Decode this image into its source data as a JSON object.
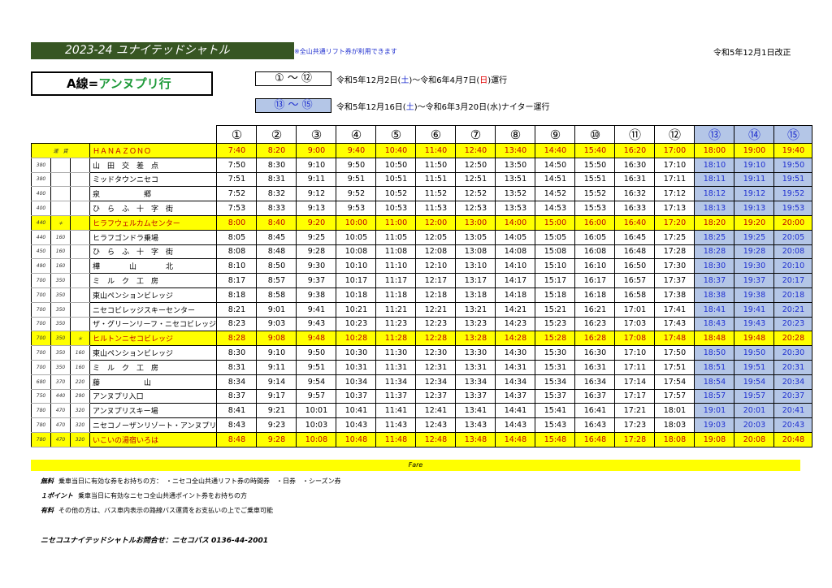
{
  "title": "2023-24  ユナイテッドシャトル",
  "note": "※全山共通リフト券が利用できます",
  "revision": "令和5年12月1日改正",
  "route": {
    "prefix": "A線=",
    "name": "アンヌプリ行"
  },
  "legend1": {
    "label": "① ～ ⑫",
    "p1": "令和5年12月2日(",
    "d1": "土",
    "p2": ")～令和6年4月7日(",
    "d2": "日",
    "p3": ")運行"
  },
  "legend2": {
    "label": "⑬ ～ ⑮",
    "p1": "令和5年12月16日(",
    "d1": "土",
    "p2": ")～令和6年3月20日(水)ナイター運行"
  },
  "trip_labels": [
    "①",
    "②",
    "③",
    "④",
    "⑤",
    "⑥",
    "⑦",
    "⑧",
    "⑨",
    "⑩",
    "⑪",
    "⑫",
    "⑬",
    "⑭",
    "⑮"
  ],
  "fare_header": "運　賃",
  "stops": [
    {
      "name": "ＨＡＮＡＺＯＮＯ",
      "f1": "",
      "f2": "",
      "f3": "",
      "hl": true,
      "times": [
        "7:40",
        "8:20",
        "9:00",
        "9:40",
        "10:40",
        "11:40",
        "12:40",
        "13:40",
        "14:40",
        "15:40",
        "16:20",
        "17:00",
        "18:00",
        "19:00",
        "19:40"
      ]
    },
    {
      "name": "山　田　交　差　点",
      "f1": "380",
      "f2": "",
      "f3": "",
      "times": [
        "7:50",
        "8:30",
        "9:10",
        "9:50",
        "10:50",
        "11:50",
        "12:50",
        "13:50",
        "14:50",
        "15:50",
        "16:30",
        "17:10",
        "18:10",
        "19:10",
        "19:50"
      ]
    },
    {
      "name": "ミッドタウンニセコ",
      "f1": "380",
      "f2": "",
      "f3": "",
      "times": [
        "7:51",
        "8:31",
        "9:11",
        "9:51",
        "10:51",
        "11:51",
        "12:51",
        "13:51",
        "14:51",
        "15:51",
        "16:31",
        "17:11",
        "18:11",
        "19:11",
        "19:51"
      ]
    },
    {
      "name": "泉　　　　　　郷",
      "f1": "400",
      "f2": "",
      "f3": "",
      "times": [
        "7:52",
        "8:32",
        "9:12",
        "9:52",
        "10:52",
        "11:52",
        "12:52",
        "13:52",
        "14:52",
        "15:52",
        "16:32",
        "17:12",
        "18:12",
        "19:12",
        "19:52"
      ]
    },
    {
      "name": "ひ　ら　ふ　十　字　街",
      "f1": "400",
      "f2": "",
      "f3": "",
      "times": [
        "7:53",
        "8:33",
        "9:13",
        "9:53",
        "10:53",
        "11:53",
        "12:53",
        "13:53",
        "14:53",
        "15:53",
        "16:33",
        "17:13",
        "18:13",
        "19:13",
        "19:53"
      ]
    },
    {
      "name": "ヒラフウェルカムセンター",
      "f1": "440",
      "f2": "＊",
      "f3": "",
      "hl": true,
      "times": [
        "8:00",
        "8:40",
        "9:20",
        "10:00",
        "11:00",
        "12:00",
        "13:00",
        "14:00",
        "15:00",
        "16:00",
        "16:40",
        "17:20",
        "18:20",
        "19:20",
        "20:00"
      ]
    },
    {
      "name": "ヒラフゴンドラ乗場",
      "f1": "440",
      "f2": "160",
      "f3": "",
      "times": [
        "8:05",
        "8:45",
        "9:25",
        "10:05",
        "11:05",
        "12:05",
        "13:05",
        "14:05",
        "15:05",
        "16:05",
        "16:45",
        "17:25",
        "18:25",
        "19:25",
        "20:05"
      ]
    },
    {
      "name": "ひ　ら　ふ　十　字　街",
      "f1": "450",
      "f2": "160",
      "f3": "",
      "times": [
        "8:08",
        "8:48",
        "9:28",
        "10:08",
        "11:08",
        "12:08",
        "13:08",
        "14:08",
        "15:08",
        "16:08",
        "16:48",
        "17:28",
        "18:28",
        "19:28",
        "20:08"
      ]
    },
    {
      "name": "樺　　　　山　　　　北",
      "f1": "490",
      "f2": "160",
      "f3": "",
      "times": [
        "8:10",
        "8:50",
        "9:30",
        "10:10",
        "11:10",
        "12:10",
        "13:10",
        "14:10",
        "15:10",
        "16:10",
        "16:50",
        "17:30",
        "18:30",
        "19:30",
        "20:10"
      ]
    },
    {
      "name": "ミ　ル　ク　工　房",
      "f1": "700",
      "f2": "350",
      "f3": "",
      "times": [
        "8:17",
        "8:57",
        "9:37",
        "10:17",
        "11:17",
        "12:17",
        "13:17",
        "14:17",
        "15:17",
        "16:17",
        "16:57",
        "17:37",
        "18:37",
        "19:37",
        "20:17"
      ]
    },
    {
      "name": "東山ペンションビレッジ",
      "f1": "700",
      "f2": "350",
      "f3": "",
      "times": [
        "8:18",
        "8:58",
        "9:38",
        "10:18",
        "11:18",
        "12:18",
        "13:18",
        "14:18",
        "15:18",
        "16:18",
        "16:58",
        "17:38",
        "18:38",
        "19:38",
        "20:18"
      ]
    },
    {
      "name": "ニセコビレッジスキーセンター",
      "f1": "700",
      "f2": "350",
      "f3": "",
      "times": [
        "8:21",
        "9:01",
        "9:41",
        "10:21",
        "11:21",
        "12:21",
        "13:21",
        "14:21",
        "15:21",
        "16:21",
        "17:01",
        "17:41",
        "18:41",
        "19:41",
        "20:21"
      ]
    },
    {
      "name": "ザ・グリーンリーフ・ニセコビレッジ",
      "f1": "700",
      "f2": "350",
      "f3": "",
      "times": [
        "8:23",
        "9:03",
        "9:43",
        "10:23",
        "11:23",
        "12:23",
        "13:23",
        "14:23",
        "15:23",
        "16:23",
        "17:03",
        "17:43",
        "18:43",
        "19:43",
        "20:23"
      ]
    },
    {
      "name": "ヒルトンニセコビレッジ",
      "f1": "700",
      "f2": "350",
      "f3": "＊",
      "hl": true,
      "times": [
        "8:28",
        "9:08",
        "9:48",
        "10:28",
        "11:28",
        "12:28",
        "13:28",
        "14:28",
        "15:28",
        "16:28",
        "17:08",
        "17:48",
        "18:48",
        "19:48",
        "20:28"
      ]
    },
    {
      "name": "東山ペンションビレッジ",
      "f1": "700",
      "f2": "350",
      "f3": "160",
      "times": [
        "8:30",
        "9:10",
        "9:50",
        "10:30",
        "11:30",
        "12:30",
        "13:30",
        "14:30",
        "15:30",
        "16:30",
        "17:10",
        "17:50",
        "18:50",
        "19:50",
        "20:30"
      ]
    },
    {
      "name": "ミ　ル　ク　工　房",
      "f1": "700",
      "f2": "350",
      "f3": "160",
      "times": [
        "8:31",
        "9:11",
        "9:51",
        "10:31",
        "11:31",
        "12:31",
        "13:31",
        "14:31",
        "15:31",
        "16:31",
        "17:11",
        "17:51",
        "18:51",
        "19:51",
        "20:31"
      ]
    },
    {
      "name": "藤　　　　　　山",
      "f1": "680",
      "f2": "370",
      "f3": "220",
      "times": [
        "8:34",
        "9:14",
        "9:54",
        "10:34",
        "11:34",
        "12:34",
        "13:34",
        "14:34",
        "15:34",
        "16:34",
        "17:14",
        "17:54",
        "18:54",
        "19:54",
        "20:34"
      ]
    },
    {
      "name": "アンヌプリ入口",
      "f1": "750",
      "f2": "440",
      "f3": "290",
      "times": [
        "8:37",
        "9:17",
        "9:57",
        "10:37",
        "11:37",
        "12:37",
        "13:37",
        "14:37",
        "15:37",
        "16:37",
        "17:17",
        "17:57",
        "18:57",
        "19:57",
        "20:37"
      ]
    },
    {
      "name": "アンヌプリスキー場",
      "f1": "780",
      "f2": "470",
      "f3": "320",
      "times": [
        "8:41",
        "9:21",
        "10:01",
        "10:41",
        "11:41",
        "12:41",
        "13:41",
        "14:41",
        "15:41",
        "16:41",
        "17:21",
        "18:01",
        "19:01",
        "20:01",
        "20:41"
      ]
    },
    {
      "name": "ニセコノーザンリゾート・アンヌプリ",
      "f1": "780",
      "f2": "470",
      "f3": "320",
      "times": [
        "8:43",
        "9:23",
        "10:03",
        "10:43",
        "11:43",
        "12:43",
        "13:43",
        "14:43",
        "15:43",
        "16:43",
        "17:23",
        "18:03",
        "19:03",
        "20:03",
        "20:43"
      ]
    },
    {
      "name": "いこいの湯宿いろは",
      "f1": "780",
      "f2": "470",
      "f3": "320",
      "hl": true,
      "times": [
        "8:48",
        "9:28",
        "10:08",
        "10:48",
        "11:48",
        "12:48",
        "13:48",
        "14:48",
        "15:48",
        "16:48",
        "17:28",
        "18:08",
        "19:08",
        "20:08",
        "20:48"
      ]
    }
  ],
  "fare_bar": "Fare",
  "footnotes": [
    {
      "label": "無料",
      "text": "乗車当日に有効な券をお持ちの方：　・ニセコ全山共通リフト券の時間券　・日券　・シーズン券"
    },
    {
      "label": "１ポイント",
      "text": "乗車当日に有効なニセコ全山共通ポイント券をお持ちの方"
    },
    {
      "label": "有料",
      "text": "その他の方は、バス車内表示の路線バス運賃をお支払いの上でご乗車可能"
    }
  ],
  "inquiry": "ニセコユナイテッドシャトルお問合せ：ニセコバス 0136-44-2001"
}
